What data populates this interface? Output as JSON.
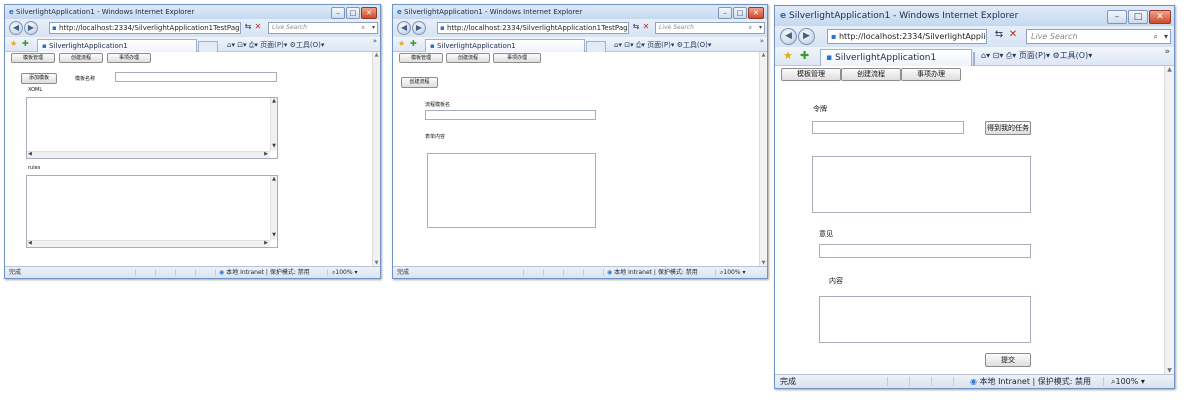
{
  "windows": [
    {
      "title": "SilverlightApplication1 - Windows Internet Explorer",
      "url": "http://localhost:2334/SilverlightApplication1TestPage.aspx",
      "search_placeholder": "Live Search",
      "tab_label": "SilverlightApplication1",
      "tools": [
        "页面(P)",
        "工具(O)"
      ],
      "app_tabs": [
        "模板管理",
        "创建流程",
        "事项办理"
      ],
      "form": {
        "add_button": "添加模板",
        "name_label": "模板名称",
        "xoml_label": "XOML",
        "rules_label": "rules"
      },
      "status": {
        "text": "完成",
        "zone": "本地 Intranet | 保护模式: 禁用",
        "zoom": "100%"
      }
    },
    {
      "title": "SilverlightApplication1 - Windows Internet Explorer",
      "url": "http://localhost:2334/SilverlightApplication1TestPage.aspx",
      "search_placeholder": "Live Search",
      "tab_label": "SilverlightApplication1",
      "tools": [
        "页面(P)",
        "工具(O)"
      ],
      "app_tabs": [
        "模板管理",
        "创建流程",
        "事项办理"
      ],
      "form": {
        "create_button": "创建流程",
        "template_label": "流程模板名",
        "form_content_label": "表单内容"
      },
      "status": {
        "text": "完成",
        "zone": "本地 Intranet | 保护模式: 禁用",
        "zoom": "100%"
      }
    },
    {
      "title": "SilverlightApplication1 - Windows Internet Explorer",
      "url": "http://localhost:2334/SilverlightApplicat",
      "search_placeholder": "Live Search",
      "tab_label": "SilverlightApplication1",
      "tools": [
        "页面(P)",
        "工具(O)"
      ],
      "app_tabs": [
        "模板管理",
        "创建流程",
        "事项办理"
      ],
      "form": {
        "token_label": "令牌",
        "get_tasks_button": "得到我的任务",
        "opinion_label": "意见",
        "content_label": "内容",
        "submit_button": "提交"
      },
      "status": {
        "text": "完成",
        "zone": "本地 Intranet | 保护模式: 禁用",
        "zoom": "100%"
      }
    }
  ],
  "icons": {
    "back": "left-arrow-icon",
    "forward": "right-arrow-icon",
    "refresh": "refresh-icon",
    "stop": "stop-icon",
    "search": "magnifier-icon",
    "favorites": "star-icon",
    "home": "home-icon",
    "feeds": "feed-icon",
    "print": "printer-icon",
    "zone": "globe-icon",
    "zoom": "zoom-icon"
  },
  "colors": {
    "frame_border": "#6f93c5",
    "close_button": "#cc4a2c",
    "chrome_bg": "#dde7f4"
  }
}
